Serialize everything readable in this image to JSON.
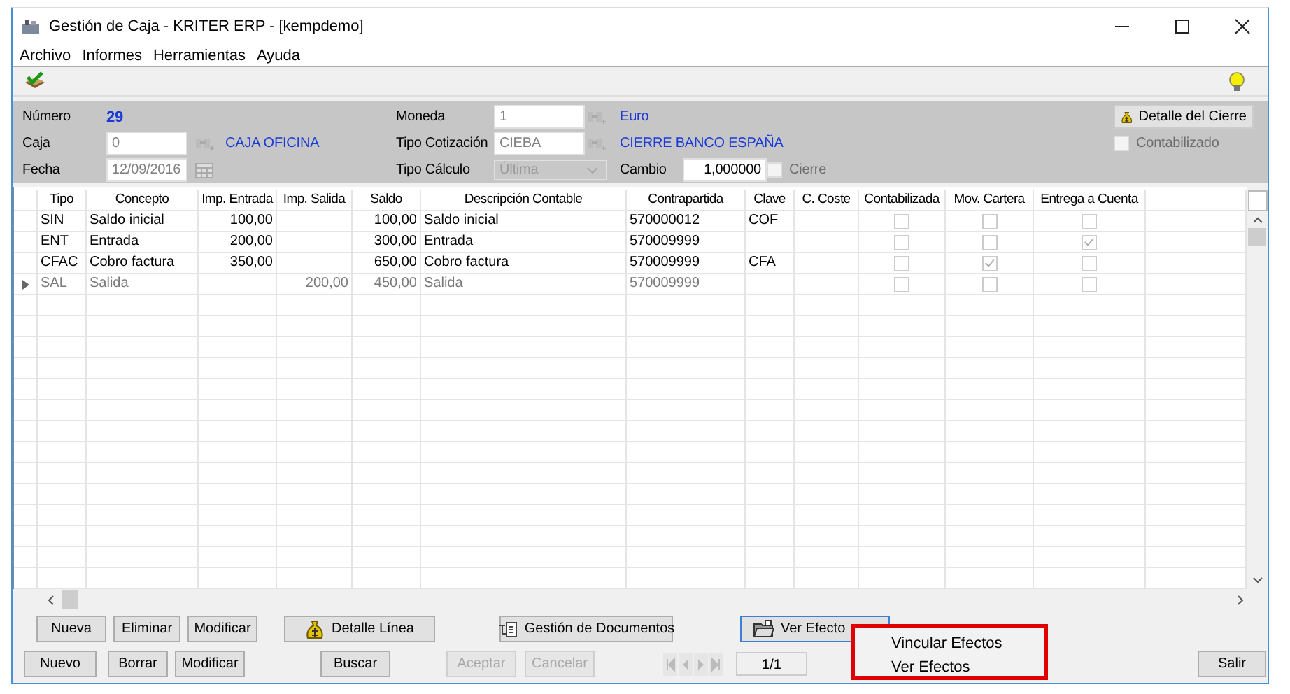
{
  "window": {
    "title": "Gestión de Caja - KRITER ERP - [kempdemo]"
  },
  "menu": [
    "Archivo",
    "Informes",
    "Herramientas",
    "Ayuda"
  ],
  "header": {
    "numero": {
      "label": "Número",
      "value": "29"
    },
    "caja": {
      "label": "Caja",
      "value": "0",
      "name": "CAJA OFICINA"
    },
    "fecha": {
      "label": "Fecha",
      "value": "12/09/2016"
    },
    "moneda": {
      "label": "Moneda",
      "value": "1",
      "name": "Euro"
    },
    "tipo_cotizacion": {
      "label": "Tipo Cotización",
      "value": "CIEBA",
      "name": "CIERRE BANCO ESPAÑA"
    },
    "tipo_calculo": {
      "label": "Tipo Cálculo",
      "value": "Última"
    },
    "cambio": {
      "label": "Cambio",
      "value": "1,000000"
    },
    "cierre": {
      "label": "Cierre",
      "checked": false
    },
    "detalle_cierre": "Detalle del Cierre",
    "contabilizado": {
      "label": "Contabilizado",
      "checked": false
    }
  },
  "table": {
    "columns": [
      "Tipo",
      "Concepto",
      "Imp. Entrada",
      "Imp. Salida",
      "Saldo",
      "Descripción Contable",
      "Contrapartida",
      "Clave",
      "C. Coste",
      "Contabilizada",
      "Mov. Cartera",
      "Entrega a Cuenta"
    ],
    "rows": [
      {
        "tipo": "SIN",
        "concepto": "Saldo inicial",
        "imp_entrada": "100,00",
        "saldo": "100,00",
        "descripcion": "Saldo inicial",
        "contrapartida": "570000012",
        "clave": "COF",
        "contabilizada": false,
        "mov_cartera": false,
        "entrega_a_cuenta": false,
        "current": false
      },
      {
        "tipo": "ENT",
        "concepto": "Entrada",
        "imp_entrada": "200,00",
        "saldo": "300,00",
        "descripcion": "Entrada",
        "contrapartida": "570009999",
        "contabilizada": false,
        "mov_cartera": false,
        "entrega_a_cuenta": true,
        "current": false
      },
      {
        "tipo": "CFAC",
        "concepto": "Cobro factura",
        "imp_entrada": "350,00",
        "saldo": "650,00",
        "descripcion": "Cobro factura",
        "contrapartida": "570009999",
        "clave": "CFA",
        "contabilizada": false,
        "mov_cartera": true,
        "entrega_a_cuenta": false,
        "current": false
      },
      {
        "tipo": "SAL",
        "concepto": "Salida",
        "imp_salida": "200,00",
        "saldo": "450,00",
        "descripcion": "Salida",
        "contrapartida": "570009999",
        "contabilizada": false,
        "mov_cartera": false,
        "entrega_a_cuenta": false,
        "current": true
      }
    ]
  },
  "line_buttons": [
    {
      "label": "Nueva",
      "kind": "plain",
      "focused": false
    },
    {
      "label": "Eliminar",
      "kind": "plain",
      "focused": false
    },
    {
      "label": "Modificar",
      "kind": "plain",
      "focused": false
    },
    {
      "label": "Detalle Línea",
      "kind": "money",
      "focused": false
    },
    {
      "label": "Gestión de Documentos",
      "kind": "documents",
      "focused": false
    },
    {
      "label": "Ver Efecto",
      "kind": "folder",
      "focused": true
    }
  ],
  "main_buttons": [
    {
      "label": "Nuevo",
      "disabled": false
    },
    {
      "label": "Borrar",
      "disabled": false
    },
    {
      "label": "Modificar",
      "disabled": false
    },
    {
      "label": "Buscar",
      "disabled": false
    },
    {
      "label": "Aceptar",
      "disabled": true
    },
    {
      "label": "Cancelar",
      "disabled": true
    }
  ],
  "page": "1/1",
  "exit_button": "Salir",
  "popup_menu": [
    "Vincular Efectos",
    "Ver Efectos"
  ]
}
